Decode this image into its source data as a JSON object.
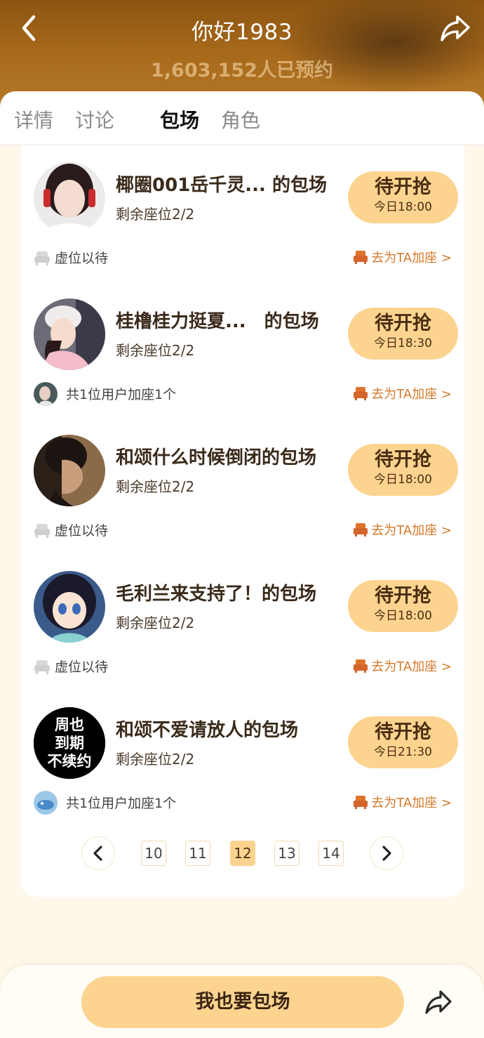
{
  "header": {
    "title": "你好1983",
    "subtitle": "1,603,152人已预约"
  },
  "tabs": [
    {
      "label": "详情",
      "active": false
    },
    {
      "label": "讨论",
      "active": false
    },
    {
      "label": "包场",
      "active": true
    },
    {
      "label": "角色",
      "active": false
    }
  ],
  "items": [
    {
      "title": "椰圈001岳千灵... 的包场",
      "seats": "剩余座位2/2",
      "button_main": "待开抢",
      "button_time": "今日18:00",
      "status": "虚位以待",
      "add_seat": "去为TA加座 >"
    },
    {
      "title": "桂橹桂力挺夏...　的包场",
      "seats": "剩余座位2/2",
      "button_main": "待开抢",
      "button_time": "今日18:30",
      "status": "共1位用户加座1个",
      "add_seat": "去为TA加座 >"
    },
    {
      "title": "和颂什么时候倒闭的包场",
      "seats": "剩余座位2/2",
      "button_main": "待开抢",
      "button_time": "今日18:00",
      "status": "虚位以待",
      "add_seat": "去为TA加座 >"
    },
    {
      "title": "毛利兰来支持了！的包场",
      "seats": "剩余座位2/2",
      "button_main": "待开抢",
      "button_time": "今日18:00",
      "status": "虚位以待",
      "add_seat": "去为TA加座 >"
    },
    {
      "title": "和颂不爱请放人的包场",
      "seats": "剩余座位2/2",
      "button_main": "待开抢",
      "button_time": "今日21:30",
      "status": "共1位用户加座1个",
      "add_seat": "去为TA加座 >",
      "avatar_text": [
        "周也",
        "到期",
        "不续约"
      ]
    }
  ],
  "pagination": {
    "pages": [
      "10",
      "11",
      "12",
      "13",
      "14"
    ],
    "current": "12"
  },
  "bottom": {
    "main_button": "我也要包场"
  },
  "colors": {
    "accent": "#fcd48f",
    "link": "#d4792a",
    "header_brown": "#a7681a"
  }
}
